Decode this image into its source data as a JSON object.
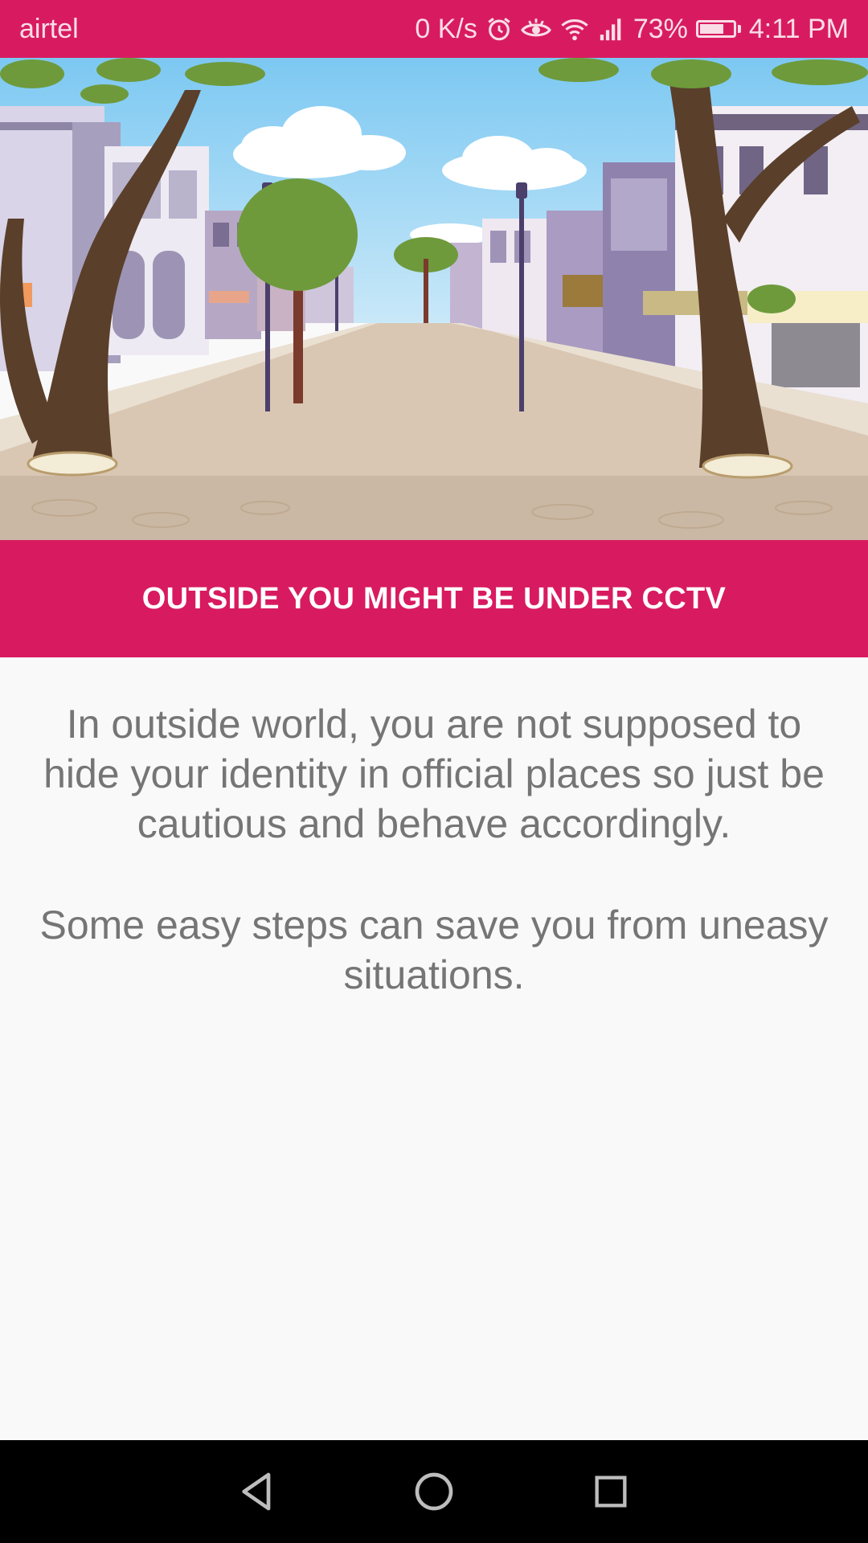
{
  "status_bar": {
    "carrier": "airtel",
    "net_speed": "0 K/s",
    "battery_percent": "73%",
    "battery_level": 0.73,
    "time": "4:11 PM",
    "icons": [
      "alarm-icon",
      "eye-icon",
      "wifi-icon",
      "signal-icon",
      "battery-icon"
    ]
  },
  "hero": {
    "image": "street-illustration",
    "colors": {
      "sky": "#7cc8f2",
      "road": "#d9c7b3",
      "trunk": "#5a3f2a",
      "foliage": "#6e9a3c"
    }
  },
  "banner": {
    "title": "OUTSIDE YOU MIGHT BE UNDER CCTV",
    "color": "#d81b60"
  },
  "content": {
    "paragraph1": "In outside world, you are not supposed to hide your identity in official places so just be cautious and behave accordingly.",
    "paragraph2": "Some easy steps can save you from uneasy situations."
  },
  "nav_bar": {
    "buttons": [
      "back-icon",
      "home-icon",
      "recents-icon"
    ]
  }
}
